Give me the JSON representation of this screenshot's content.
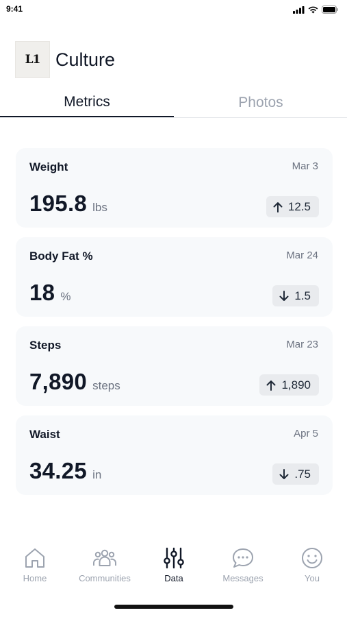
{
  "status": {
    "time": "9:41"
  },
  "header": {
    "logo_text": "L1",
    "title": "Culture"
  },
  "tabs": [
    {
      "label": "Metrics",
      "active": true
    },
    {
      "label": "Photos",
      "active": false
    }
  ],
  "metrics": [
    {
      "label": "Weight",
      "date": "Mar 3",
      "value": "195.8",
      "unit": "lbs",
      "delta": "12.5",
      "direction": "up"
    },
    {
      "label": "Body Fat %",
      "date": "Mar 24",
      "value": "18",
      "unit": "%",
      "delta": "1.5",
      "direction": "down"
    },
    {
      "label": "Steps",
      "date": "Mar 23",
      "value": "7,890",
      "unit": "steps",
      "delta": "1,890",
      "direction": "up"
    },
    {
      "label": "Waist",
      "date": "Apr 5",
      "value": "34.25",
      "unit": "in",
      "delta": ".75",
      "direction": "down"
    }
  ],
  "tabbar": [
    {
      "label": "Home",
      "icon": "home-icon",
      "active": false
    },
    {
      "label": "Communities",
      "icon": "communities-icon",
      "active": false
    },
    {
      "label": "Data",
      "icon": "sliders-icon",
      "active": true
    },
    {
      "label": "Messages",
      "icon": "chat-bubble-icon",
      "active": false
    },
    {
      "label": "You",
      "icon": "smiley-icon",
      "active": false
    }
  ],
  "colors": {
    "text": "#111827",
    "muted": "#9ca3af",
    "card_bg": "#f7f9fb",
    "badge_bg": "#e9ebee"
  }
}
